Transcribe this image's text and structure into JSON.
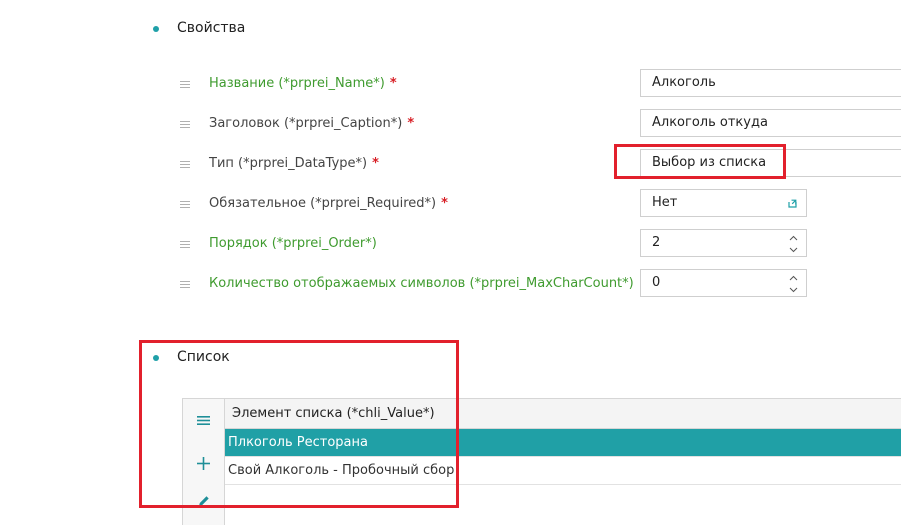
{
  "properties_section": {
    "title": "Свойства"
  },
  "fields": [
    {
      "label": "Название (*prprei_Name*)",
      "required": "*",
      "value": "Алкоголь"
    },
    {
      "label": "Заголовок (*prprei_Caption*)",
      "required": "*",
      "value": "Алкоголь откуда"
    },
    {
      "label": "Тип (*prprei_DataType*)",
      "required": "*",
      "value": "Выбор из списка"
    },
    {
      "label": "Обязательное (*prprei_Required*)",
      "required": "*",
      "value": "Нет"
    },
    {
      "label": "Порядок (*prprei_Order*)",
      "required": "",
      "value": "2"
    },
    {
      "label": "Количество отображаемых символов (*prprei_MaxCharCount*)",
      "required": "",
      "value": "0"
    }
  ],
  "list_section": {
    "title": "Список",
    "column_header": "Элемент списка (*chli_Value*)",
    "rows": [
      {
        "value": "Плкоголь Ресторана",
        "selected": true
      },
      {
        "value": "Свой Алкоголь - Пробочный сбор",
        "selected": false
      }
    ],
    "toolbar": [
      {
        "icon": "menu-icon"
      },
      {
        "icon": "plus-icon"
      },
      {
        "icon": "pencil-icon"
      }
    ]
  },
  "colors": {
    "accent": "#20a0a6",
    "label_green": "#3f9b2f",
    "required_red": "#d81f26",
    "highlight_red": "#e2202c"
  }
}
